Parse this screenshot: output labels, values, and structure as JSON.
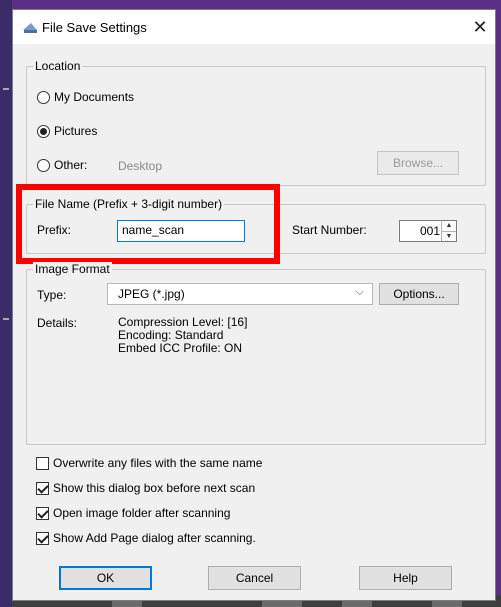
{
  "window": {
    "title": "File Save Settings",
    "close_glyph": "✕",
    "icon": "scanner-app-icon"
  },
  "location": {
    "group_label": "Location",
    "options": [
      {
        "label": "My Documents",
        "selected": false
      },
      {
        "label": "Pictures",
        "selected": true
      },
      {
        "label": "Other:",
        "selected": false
      }
    ],
    "other_path": "Desktop",
    "browse_label": "Browse..."
  },
  "file_name": {
    "group_label": "File Name (Prefix + 3-digit number)",
    "prefix_label": "Prefix:",
    "prefix_value": "name_scan",
    "start_number_label": "Start Number:",
    "start_number_value": "001"
  },
  "image_format": {
    "group_label": "Image Format",
    "type_label": "Type:",
    "type_value": "JPEG (*.jpg)",
    "options_label": "Options...",
    "details_label": "Details:",
    "details_lines": [
      "Compression Level: [16]",
      "Encoding: Standard",
      "Embed ICC Profile: ON"
    ]
  },
  "checkboxes": [
    {
      "label": "Overwrite any files with the same name",
      "checked": false
    },
    {
      "label": "Show this dialog box before next scan",
      "checked": true
    },
    {
      "label": "Open image folder after scanning",
      "checked": true
    },
    {
      "label": "Show Add Page dialog after scanning.",
      "checked": true
    }
  ],
  "buttons": {
    "ok": "OK",
    "cancel": "Cancel",
    "help": "Help"
  },
  "colors": {
    "highlight": "#ff0000",
    "background_window": "#5a2f86",
    "focus_blue": "#0078d7"
  }
}
